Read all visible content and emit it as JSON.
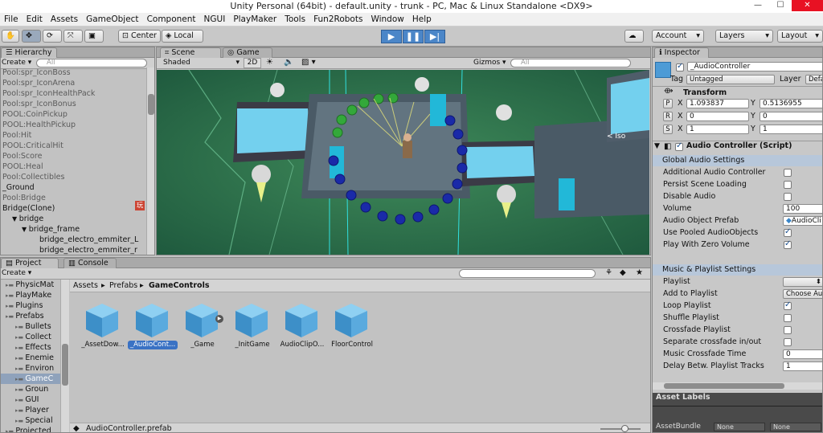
{
  "window": {
    "title": "Unity Personal (64bit) - default.unity - trunk - PC, Mac & Linux Standalone <DX9>",
    "minimize": "—",
    "maximize": "☐",
    "close": "✕"
  },
  "menu": [
    "File",
    "Edit",
    "Assets",
    "GameObject",
    "Component",
    "NGUI",
    "PlayMaker",
    "Tools",
    "Fun2Robots",
    "Window",
    "Help"
  ],
  "toolbar": {
    "center": "Center",
    "local": "Local",
    "account": "Account",
    "layers": "Layers",
    "layout": "Layout"
  },
  "hierarchy": {
    "tab": "Hierarchy",
    "create": "Create",
    "search": "All",
    "items": [
      {
        "label": "Pool:spr_IconBoss",
        "indent": 0,
        "arrow": ""
      },
      {
        "label": "Pool:spr_IconArena",
        "indent": 0,
        "arrow": ""
      },
      {
        "label": "Pool:spr_IconHealthPack",
        "indent": 0,
        "arrow": ""
      },
      {
        "label": "Pool:spr_IconBonus",
        "indent": 0,
        "arrow": ""
      },
      {
        "label": "POOL:CoinPickup",
        "indent": 0,
        "arrow": ""
      },
      {
        "label": "POOL:HealthPickup",
        "indent": 0,
        "arrow": ""
      },
      {
        "label": "Pool:Hit",
        "indent": 0,
        "arrow": ""
      },
      {
        "label": "POOL:CriticalHit",
        "indent": 0,
        "arrow": ""
      },
      {
        "label": "Pool:Score",
        "indent": 0,
        "arrow": ""
      },
      {
        "label": "POOL:Heal",
        "indent": 0,
        "arrow": ""
      },
      {
        "label": "Pool:Collectibles",
        "indent": 0,
        "arrow": ""
      },
      {
        "label": "_Ground",
        "indent": 0,
        "arrow": ""
      },
      {
        "label": "Pool:Bridge",
        "indent": 0,
        "arrow": ""
      },
      {
        "label": "Bridge(Clone)",
        "indent": 0,
        "arrow": ""
      },
      {
        "label": "bridge",
        "indent": 1,
        "arrow": "▼"
      },
      {
        "label": "bridge_frame",
        "indent": 2,
        "arrow": "▼"
      },
      {
        "label": "bridge_electro_emmiter_L",
        "indent": 3,
        "arrow": ""
      },
      {
        "label": "bridge_electro_emmiter_r",
        "indent": 3,
        "arrow": ""
      }
    ],
    "badge": "玩"
  },
  "scene": {
    "tab_scene": "Scene",
    "tab_game": "Game",
    "shaded": "Shaded",
    "mode2d": "2D",
    "gizmos": "Gizmos",
    "search": "All",
    "iso_label": "< Iso"
  },
  "project": {
    "tab_project": "Project",
    "tab_console": "Console",
    "create": "Create",
    "tree": [
      {
        "label": "PhysicMat",
        "indent": 1
      },
      {
        "label": "PlayMake",
        "indent": 1
      },
      {
        "label": "Plugins",
        "indent": 1
      },
      {
        "label": "Prefabs",
        "indent": 1
      },
      {
        "label": "Bullets",
        "indent": 2
      },
      {
        "label": "Collect",
        "indent": 2
      },
      {
        "label": "Effects",
        "indent": 2
      },
      {
        "label": "Enemie",
        "indent": 2
      },
      {
        "label": "Environ",
        "indent": 2
      },
      {
        "label": "GameC",
        "indent": 2
      },
      {
        "label": "Groun",
        "indent": 2
      },
      {
        "label": "GUI",
        "indent": 2
      },
      {
        "label": "Player",
        "indent": 2
      },
      {
        "label": "Special",
        "indent": 2
      },
      {
        "label": "Projected",
        "indent": 1
      }
    ],
    "breadcrumb": [
      "Assets",
      "Prefabs",
      "GameControls"
    ],
    "assets": [
      "_AssetDow...",
      "_AudioCont...",
      "_Game",
      "_InitGame",
      "AudioClipO...",
      "FloorControl"
    ],
    "footer": "AudioController.prefab"
  },
  "inspector": {
    "tab": "Inspector",
    "object_name": "_AudioController",
    "tag_label": "Tag",
    "tag_value": "Untagged",
    "layer_label": "Layer",
    "layer_value": "Defa",
    "transform": {
      "title": "Transform",
      "P": "P",
      "R": "R",
      "S": "S",
      "px": "1.093837",
      "py": "0.5136955",
      "rx": "0",
      "ry": "0",
      "sx": "1",
      "sy": "1"
    },
    "component": "Audio Controller (Script)",
    "global_header": "Global Audio Settings",
    "global": [
      {
        "label": "Additional Audio Controller",
        "type": "cb",
        "on": false
      },
      {
        "label": "Persist Scene Loading",
        "type": "cb",
        "on": false
      },
      {
        "label": "Disable Audio",
        "type": "cb",
        "on": false
      },
      {
        "label": "Volume",
        "type": "slider",
        "value": "100"
      },
      {
        "label": "Audio Object Prefab",
        "type": "obj",
        "value": "AudioCli"
      },
      {
        "label": "Use Pooled AudioObjects",
        "type": "cb",
        "on": true
      },
      {
        "label": "Play With Zero Volume",
        "type": "cb",
        "on": true
      }
    ],
    "music_header": "Music & Playlist Settings",
    "music": [
      {
        "label": "Playlist",
        "type": "drop",
        "value": ""
      },
      {
        "label": "Add to Playlist",
        "type": "drop",
        "value": "Choose Au"
      },
      {
        "label": "Loop Playlist",
        "type": "cb",
        "on": true
      },
      {
        "label": "Shuffle Playlist",
        "type": "cb",
        "on": false
      },
      {
        "label": "Crossfade Playlist",
        "type": "cb",
        "on": false
      },
      {
        "label": "Separate crossfade in/out",
        "type": "cb",
        "on": false
      },
      {
        "label": "Music Crossfade Time",
        "type": "field",
        "value": "0"
      },
      {
        "label": "Delay Betw. Playlist Tracks",
        "type": "field",
        "value": "1"
      }
    ],
    "asset_labels": "Asset Labels",
    "asset_bundle": "AssetBundle",
    "bundle_value": "None",
    "bundle_value2": "None"
  }
}
